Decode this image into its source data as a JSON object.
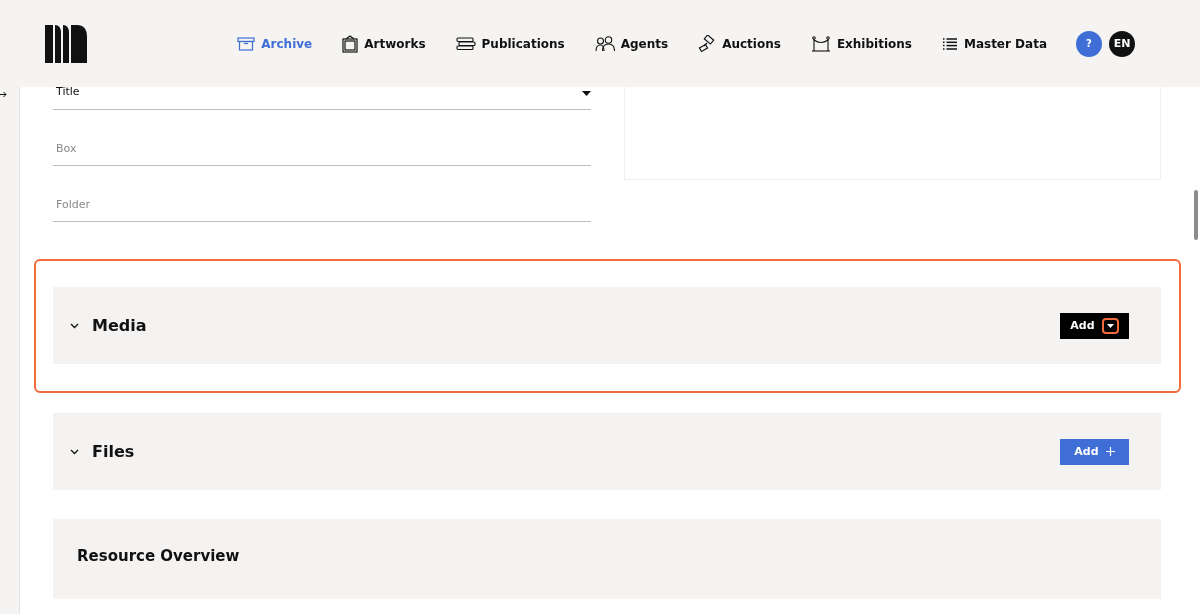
{
  "nav": {
    "items": [
      {
        "label": "Archive",
        "selected": true
      },
      {
        "label": "Artworks",
        "selected": false
      },
      {
        "label": "Publications",
        "selected": false
      },
      {
        "label": "Agents",
        "selected": false
      },
      {
        "label": "Auctions",
        "selected": false
      },
      {
        "label": "Exhibitions",
        "selected": false
      },
      {
        "label": "Master Data",
        "selected": false
      }
    ],
    "help": "?",
    "language": "EN"
  },
  "form": {
    "fields": [
      {
        "kind": "select",
        "value": "Title"
      },
      {
        "kind": "text",
        "placeholder": "Box"
      },
      {
        "kind": "text",
        "placeholder": "Folder"
      }
    ]
  },
  "sections": [
    {
      "title": "Media",
      "highlighted": true,
      "add_button": {
        "label": "Add",
        "kind": "dropdown"
      }
    },
    {
      "title": "Files",
      "highlighted": false,
      "add_button": {
        "label": "Add",
        "kind": "plus"
      }
    }
  ],
  "overview": {
    "title": "Resource Overview"
  }
}
